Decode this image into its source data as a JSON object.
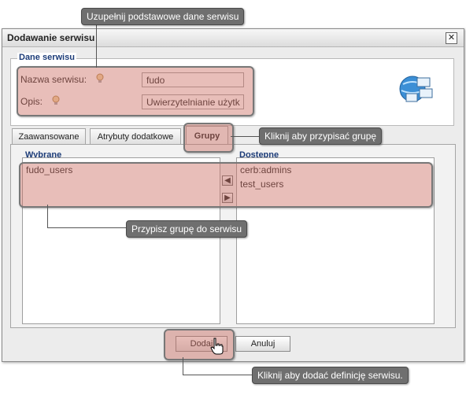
{
  "dialog": {
    "title": "Dodawanie serwisu",
    "close_glyph": "✕"
  },
  "service_data": {
    "legend": "Dane serwisu",
    "name_label": "Nazwa serwisu:",
    "name_value": "fudo",
    "description_label": "Opis:",
    "description_value": "Uwierzytelnianie użytk"
  },
  "tabs": [
    {
      "label": "Zaawansowane"
    },
    {
      "label": "Atrybuty dodatkowe"
    },
    {
      "label": "Grupy",
      "active": true
    }
  ],
  "groups": {
    "selected_legend": "Wybrane",
    "available_legend": "Dostepne",
    "selected_items": [
      "fudo_users"
    ],
    "available_items": [
      "cerb:admins",
      "test_users"
    ],
    "move_left_glyph": "🡄",
    "move_right_glyph": "🡆"
  },
  "buttons": {
    "add_label": "Dodaj",
    "cancel_label": "Anuluj"
  },
  "callouts": {
    "fill_basic": "Uzupełnij podstawowe dane serwisu",
    "assign_group_tab": "Kliknij aby przypisać grupę",
    "assign_group_service": "Przypisz grupę do serwisu",
    "add_definition": "Kliknij aby dodać definicję serwisu."
  },
  "colors": {
    "legend_blue": "#1c3c78",
    "highlight": "#cd6e64",
    "callout_bg": "#6f6f6f"
  }
}
